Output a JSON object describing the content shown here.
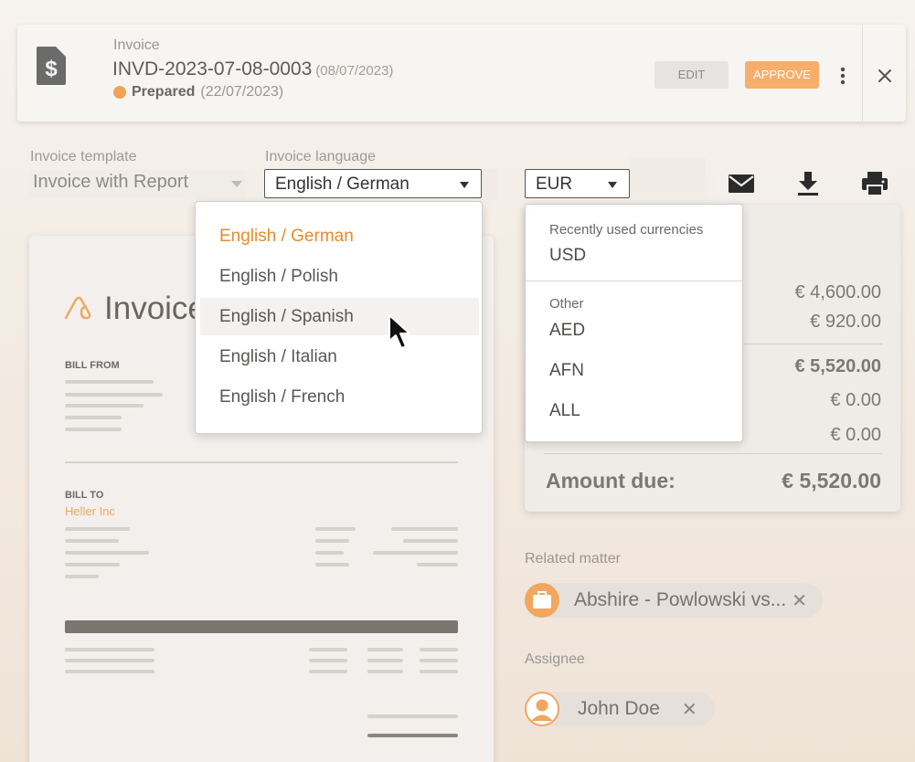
{
  "header": {
    "type_label": "Invoice",
    "number": "INVD-2023-07-08-0003",
    "date": "(08/07/2023)",
    "status": "Prepared",
    "status_date": "(22/07/2023)",
    "status_color": "#f2a257",
    "edit_label": "EDIT",
    "approve_label": "APPROVE",
    "icons": [
      "dollar-document-icon",
      "more-vertical-icon",
      "close-icon"
    ]
  },
  "form": {
    "template_label": "Invoice template",
    "template_value": "Invoice with Report",
    "language_label": "Invoice language",
    "language_value": "English / German",
    "currency_value": "EUR",
    "tools": [
      "mail-icon",
      "download-icon",
      "print-icon"
    ]
  },
  "language_menu": {
    "items": [
      "English / German",
      "English / Polish",
      "English / Spanish",
      "English / Italian",
      "English / French"
    ],
    "selected": "English / German",
    "hovered": "English / Spanish",
    "accent_color": "#e8892a"
  },
  "currency_menu": {
    "recent_label": "Recently used currencies",
    "recent": [
      "USD"
    ],
    "other_label": "Other",
    "other": [
      "AED",
      "AFN",
      "ALL"
    ]
  },
  "preview": {
    "title": "Invoice",
    "bill_from_label": "BILL FROM",
    "bill_to_label": "BILL TO",
    "client": "Heller Inc"
  },
  "totals": {
    "lines": [
      "€ 4,600.00",
      "€ 920.00",
      "€ 5,520.00",
      "€ 0.00",
      "€ 0.00"
    ],
    "amount_due_label": "Amount due:",
    "amount_due": "€ 5,520.00"
  },
  "related": {
    "label": "Related matter",
    "matter": "Abshire - Powlowski vs...",
    "assignee_label": "Assignee",
    "assignee": "John Doe",
    "remove_symbol": "✕"
  }
}
